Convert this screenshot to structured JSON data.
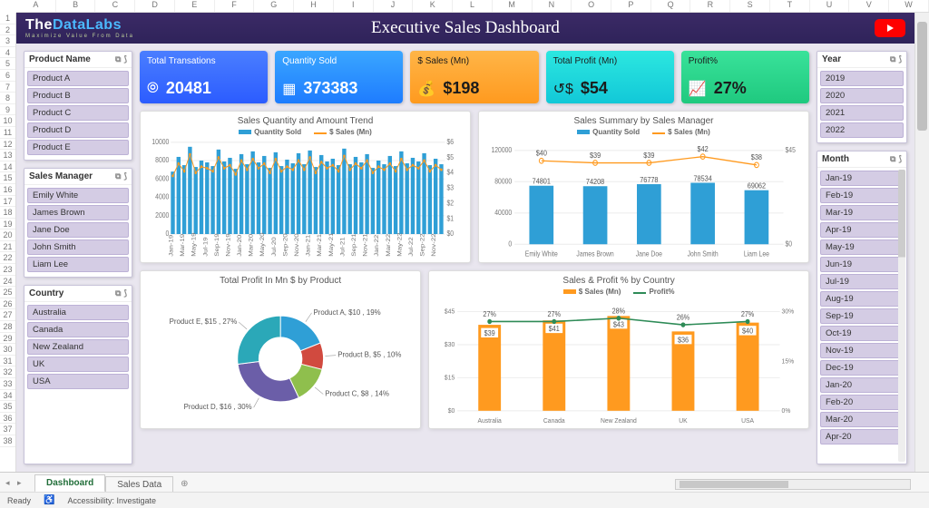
{
  "app": {
    "title": "Executive Sales Dashboard",
    "logo_the": "The",
    "logo_data": "DataLabs",
    "logo_sub": "Maximize Value From Data"
  },
  "excel": {
    "cols": [
      "A",
      "B",
      "C",
      "D",
      "E",
      "F",
      "G",
      "H",
      "I",
      "J",
      "K",
      "L",
      "M",
      "N",
      "O",
      "P",
      "Q",
      "R",
      "S",
      "T",
      "U",
      "V",
      "W"
    ],
    "rows": [
      "1",
      "2",
      "3",
      "4",
      "5",
      "6",
      "7",
      "8",
      "9",
      "10",
      "11",
      "12",
      "13",
      "14",
      "15",
      "16",
      "17",
      "18",
      "19",
      "20",
      "21",
      "22",
      "23",
      "24",
      "25",
      "26",
      "27",
      "28",
      "29",
      "30",
      "31",
      "32",
      "33",
      "34",
      "35",
      "36",
      "37",
      "38"
    ],
    "tabs": {
      "active": "Dashboard",
      "others": [
        "Sales Data"
      ]
    },
    "status": {
      "ready": "Ready",
      "access": "Accessibility: Investigate"
    }
  },
  "slicers": {
    "product": {
      "title": "Product Name",
      "items": [
        "Product A",
        "Product B",
        "Product C",
        "Product D",
        "Product E"
      ]
    },
    "manager": {
      "title": "Sales Manager",
      "items": [
        "Emily White",
        "James Brown",
        "Jane Doe",
        "John Smith",
        "Liam Lee"
      ]
    },
    "country": {
      "title": "Country",
      "items": [
        "Australia",
        "Canada",
        "New Zealand",
        "UK",
        "USA"
      ]
    },
    "year": {
      "title": "Year",
      "items": [
        "2019",
        "2020",
        "2021",
        "2022"
      ]
    },
    "month": {
      "title": "Month",
      "items": [
        "Jan-19",
        "Feb-19",
        "Mar-19",
        "Apr-19",
        "May-19",
        "Jun-19",
        "Jul-19",
        "Aug-19",
        "Sep-19",
        "Oct-19",
        "Nov-19",
        "Dec-19",
        "Jan-20",
        "Feb-20",
        "Mar-20",
        "Apr-20"
      ]
    }
  },
  "kpi": {
    "trans": {
      "label": "Total Transations",
      "value": "20481",
      "icon": "⦾"
    },
    "qty": {
      "label": "Quantity Sold",
      "value": "373383",
      "icon": "▦"
    },
    "sales": {
      "label": "$ Sales (Mn)",
      "value": "$198",
      "icon": "💰"
    },
    "profit": {
      "label": "Total Profit (Mn)",
      "value": "$54",
      "icon": "↺$"
    },
    "pct": {
      "label": "Profit%",
      "value": "27%",
      "icon": "📈"
    }
  },
  "chart_data": [
    {
      "type": "bar+line",
      "title": "Sales Quantity and Amount Trend",
      "legend": [
        "Quantity Sold",
        "$ Sales (Mn)"
      ],
      "categories": [
        "Jan-19",
        "Mar-19",
        "May-19",
        "Jul-19",
        "Sep-19",
        "Nov-19",
        "Jan-20",
        "Mar-20",
        "May-20",
        "Jul-20",
        "Sep-20",
        "Nov-20",
        "Jan-21",
        "Mar-21",
        "May-21",
        "Jul-21",
        "Sep-21",
        "Nov-21",
        "Jan-22",
        "Mar-22",
        "May-22",
        "Jul-22",
        "Sep-22",
        "Nov-22"
      ],
      "y1label": "",
      "y1ticks": [
        "0",
        "2000",
        "4000",
        "6000",
        "8000",
        "10000"
      ],
      "y2ticks": [
        "$0",
        "$1",
        "$2",
        "$3",
        "$4",
        "$5",
        "$6"
      ],
      "series": [
        {
          "name": "Quantity Sold",
          "values": [
            6800,
            8400,
            7500,
            9500,
            7300,
            8000,
            7800,
            7400,
            9200,
            7900,
            8300,
            7100,
            8700,
            7600,
            9000,
            7800,
            8500,
            7200,
            8900,
            7400,
            8100,
            7700,
            8800,
            7600,
            9100,
            7300,
            8600,
            7900,
            8200,
            7500,
            9300,
            7600,
            8400,
            7800,
            8700,
            7200,
            8000,
            7600,
            8500,
            7400,
            9000,
            7700,
            8300,
            7900,
            8800,
            7500,
            8200,
            7600
          ]
        },
        {
          "name": "$ Sales (Mn)",
          "values": [
            3.8,
            4.6,
            4.1,
            5.2,
            4.0,
            4.4,
            4.3,
            4.1,
            5.0,
            4.3,
            4.5,
            3.9,
            4.8,
            4.2,
            4.9,
            4.3,
            4.6,
            4.0,
            4.9,
            4.1,
            4.4,
            4.2,
            4.8,
            4.2,
            5.0,
            4.0,
            4.7,
            4.3,
            4.5,
            4.1,
            5.1,
            4.2,
            4.6,
            4.3,
            4.8,
            4.0,
            4.4,
            4.2,
            4.6,
            4.1,
            4.9,
            4.2,
            4.5,
            4.3,
            4.8,
            4.1,
            4.5,
            4.2
          ]
        }
      ],
      "y1max": 10000,
      "y2max": 6
    },
    {
      "type": "bar+line",
      "title": "Sales Summary by Sales Manager",
      "legend": [
        "Quantity Sold",
        "$ Sales (Mn)"
      ],
      "categories": [
        "Emily White",
        "James Brown",
        "Jane Doe",
        "John Smith",
        "Liam Lee"
      ],
      "y1ticks": [
        "0",
        "40000",
        "80000",
        "120000"
      ],
      "y2ticks": [
        "$0",
        "$45"
      ],
      "series": [
        {
          "name": "Quantity Sold",
          "values": [
            74801,
            74208,
            76778,
            78534,
            69062
          ]
        },
        {
          "name": "$ Sales (Mn)",
          "values": [
            40,
            39,
            39,
            42,
            38
          ]
        }
      ],
      "y1max": 120000,
      "y2max": 45
    },
    {
      "type": "pie",
      "title": "Total Profit In Mn $ by Product",
      "slices": [
        {
          "label": "Product A, $10 , 19%",
          "value": 19,
          "color": "#2f9fd6"
        },
        {
          "label": "Product B, $5 , 10%",
          "value": 10,
          "color": "#d14a3f"
        },
        {
          "label": "Product C, $8 , 14%",
          "value": 14,
          "color": "#8fbf4d"
        },
        {
          "label": "Product D, $16 , 30%",
          "value": 30,
          "color": "#6b5ea8"
        },
        {
          "label": "Product E, $15 , 27%",
          "value": 27,
          "color": "#2ba8b8"
        }
      ]
    },
    {
      "type": "bar+line",
      "title": "Sales & Profit % by Country",
      "legend": [
        "$ Sales (Mn)",
        "Profit%"
      ],
      "categories": [
        "Australia",
        "Canada",
        "New Zealand",
        "UK",
        "USA"
      ],
      "y1ticks": [
        "$0",
        "$15",
        "$30",
        "$45"
      ],
      "y2ticks": [
        "0%",
        "15%",
        "30%"
      ],
      "series": [
        {
          "name": "$ Sales (Mn)",
          "values": [
            39,
            41,
            43,
            36,
            40
          ]
        },
        {
          "name": "Profit%",
          "values": [
            27,
            27,
            28,
            26,
            27
          ]
        }
      ],
      "y1max": 45,
      "y2max": 30
    }
  ]
}
